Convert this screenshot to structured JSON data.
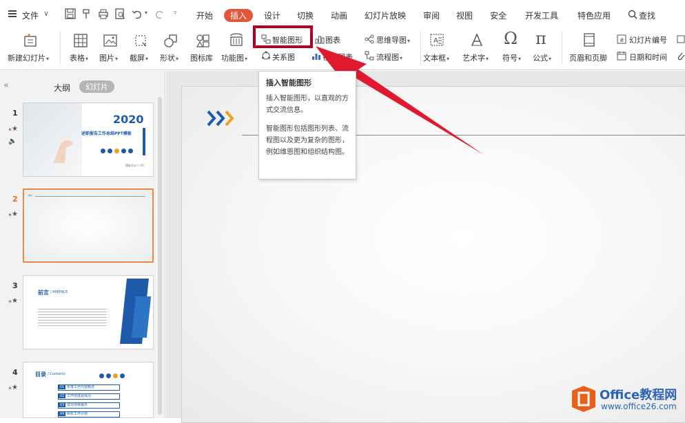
{
  "menubar": {
    "file_label": "文件",
    "tabs": [
      "开始",
      "插入",
      "设计",
      "切换",
      "动画",
      "幻灯片放映",
      "审阅",
      "视图",
      "安全",
      "开发工具",
      "特色应用"
    ],
    "active_tab": "插入",
    "search_label": "查找",
    "accent_color": "#e2563a"
  },
  "ribbon": {
    "new_slide": "新建幻灯片",
    "table": "表格",
    "picture": "图片",
    "screenshot": "截屏",
    "shape": "形状",
    "icon_lib": "图标库",
    "function_chart": "功能图",
    "smartart": "智能图形",
    "chart": "图表",
    "mindmap": "思维导图",
    "relation": "关系图",
    "online_chart": "在线图表",
    "flowchart": "流程图",
    "textbox": "文本框",
    "wordart": "艺术字",
    "symbol": "符号",
    "formula": "公式",
    "header_footer": "页眉和页脚",
    "slide_number": "幻灯片编号",
    "datetime": "日期和时间"
  },
  "panel": {
    "outline_tab": "大纲",
    "slides_tab": "幻灯片",
    "slides": [
      {
        "number": "1",
        "year": "2020",
        "title": "述职报告工作总结PPT模板",
        "footer": "模板设计人:XX"
      },
      {
        "number": "2"
      },
      {
        "number": "3",
        "heading": "前言",
        "heading_en": "/ PREFACE"
      },
      {
        "number": "4",
        "heading": "目录",
        "heading_en": "/ Contents",
        "items": [
          "年度工作内容概述",
          "工作完成及情况",
          "成功项目展示",
          "明年工作计划"
        ],
        "item_nums": [
          "01",
          "02",
          "03",
          "04"
        ]
      }
    ]
  },
  "tooltip": {
    "title": "插入智能图形",
    "line1": "插入智能图形，以直观的方式交流信息。",
    "line2": "智能图形包括图形列表、流程图以及更为复杂的图形，例如维恩图和组织结构图。"
  },
  "watermark": {
    "brand": "Office教程网",
    "url": "www.office26.com",
    "color": "#2b63b6",
    "logo_color": "#e8611a"
  },
  "colors": {
    "highlight_box": "#b0001e",
    "arrow": "#e0192e",
    "slide_accent_blue": "#1e5aa8",
    "slide_accent_orange": "#f0a020"
  }
}
